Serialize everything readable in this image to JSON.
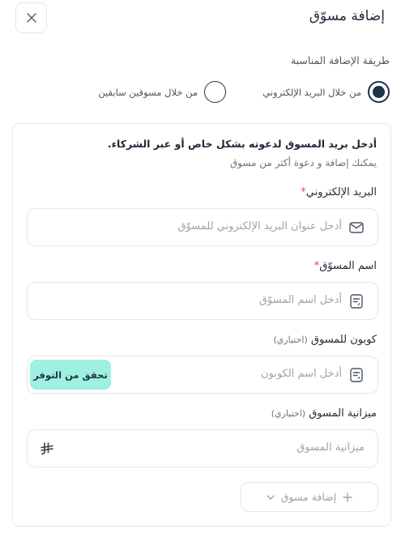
{
  "modal": {
    "title": "إضافة مسوّق"
  },
  "method": {
    "label": "طريقة الإضافة المناسبة",
    "options": [
      {
        "label": "من خلال البريد الإلكتروني",
        "selected": true
      },
      {
        "label": "من خلال مسوقين سابقين",
        "selected": false
      }
    ]
  },
  "form": {
    "intro_bold": "أدخل بريد المسوق لدعوته بشكل خاص أو عبر الشركاء.",
    "intro_sub": "يمكنك إضافة و دعوة أكثر من مسوق",
    "email": {
      "label": "البريد الإلكتروني",
      "required_mark": "*",
      "placeholder": "أدخل عنوان البريد الإلكتروني للمسوّق"
    },
    "name": {
      "label": "اسم المسوّق",
      "required_mark": "*",
      "placeholder": "أدخل اسم المسوّق"
    },
    "coupon": {
      "label": "كوبون للمسوق",
      "optional": "(اختياري)",
      "placeholder": "أدخل اسم الكوبون",
      "check_label": "تحقق من التوفر"
    },
    "budget": {
      "label": "ميزانية المسوق",
      "optional": "(اختياري)",
      "placeholder": "ميزانية المسوق"
    },
    "add_button": {
      "label": "إضافة مسوق"
    }
  },
  "colors": {
    "primary": "#1f3346",
    "accent": "#9ef0df",
    "required": "#ef4444",
    "border": "#e5e7eb",
    "placeholder": "#9ca3af"
  },
  "icons": {
    "close": "close-icon",
    "email": "mail-icon",
    "name": "document-icon",
    "coupon": "document-icon",
    "budget": "riyal-icon",
    "add": "plus-icon",
    "dropdown": "chevron-down-icon"
  }
}
